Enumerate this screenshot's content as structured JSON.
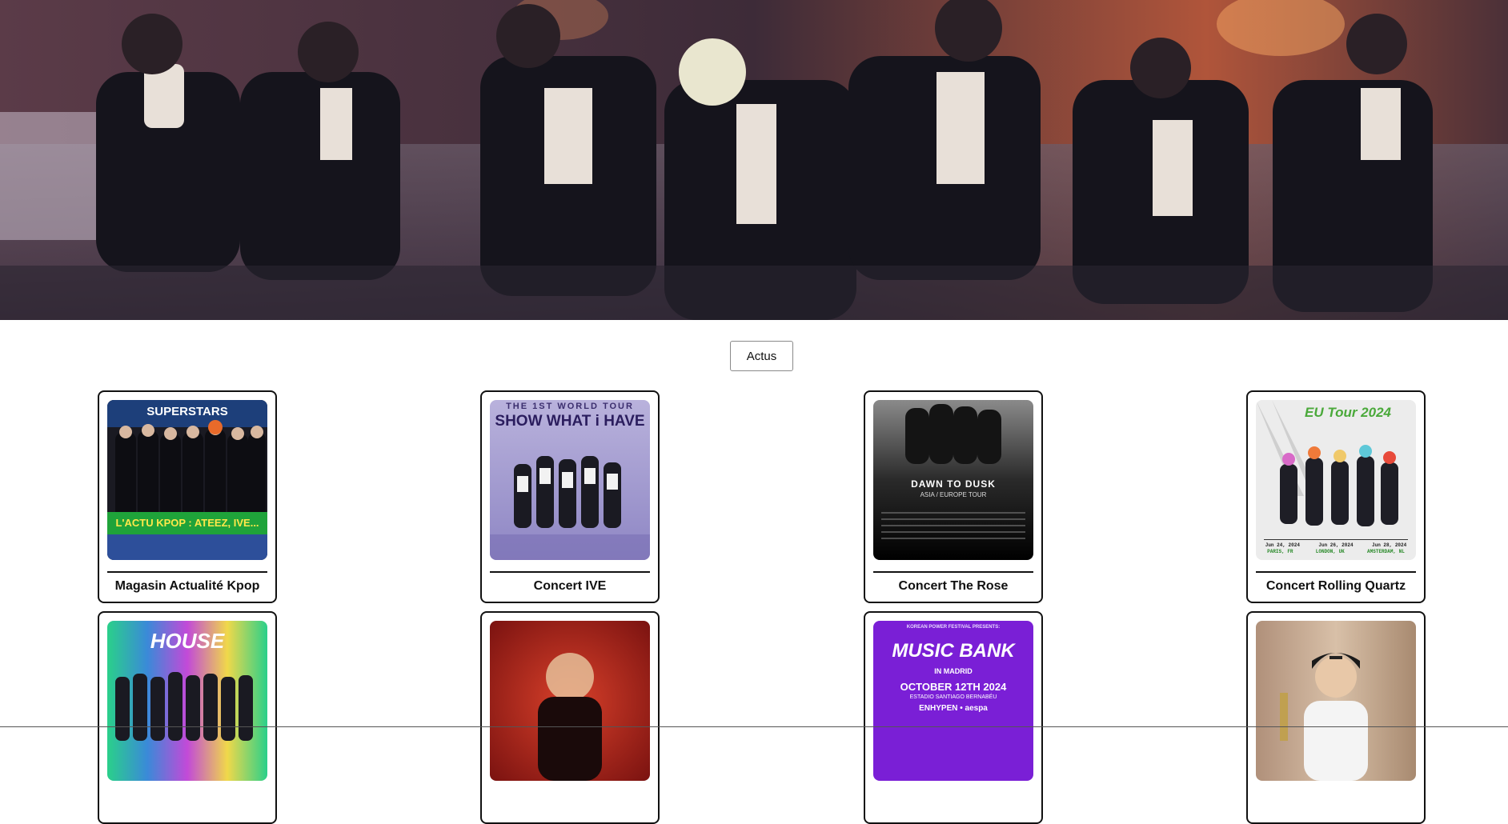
{
  "hero": {
    "image": "concert-group-photo"
  },
  "nav": {
    "actus_label": "Actus"
  },
  "cards": [
    {
      "caption": "Magasin Actualité Kpop",
      "poster_top": "SUPERSTARS",
      "poster_bottom": "L'ACTU KPOP : ATEEZ, IVE..."
    },
    {
      "caption": "Concert IVE",
      "poster_top": "THE 1ST WORLD TOUR",
      "poster_main": "SHOW WHAT i HAVE"
    },
    {
      "caption": "Concert The Rose",
      "poster_main": "DAWN TO DUSK",
      "poster_sub": "ASIA / EUROPE TOUR"
    },
    {
      "caption": "Concert Rolling Quartz",
      "poster_main": "EU Tour 2024",
      "poster_dates": [
        "Jun 24, 2024",
        "Jun 26, 2024",
        "Jun 28, 2024"
      ],
      "poster_cities": [
        "PARIS, FR",
        "LONDON, UK",
        "AMSTERDAM, NL"
      ]
    },
    {
      "caption": "",
      "poster_main": "HOUSE"
    },
    {
      "caption": "",
      "poster_main": ""
    },
    {
      "caption": "",
      "poster_top": "KOREAN POWER FESTIVAL PRESENTS:",
      "poster_main": "MUSIC BANK",
      "poster_sub": "IN MADRID",
      "poster_date": "OCTOBER 12TH 2024",
      "poster_venue": "ESTADIO SANTIAGO BERNABÉU",
      "poster_acts": "ENHYPEN • aespa"
    },
    {
      "caption": "",
      "poster_main": ""
    }
  ],
  "colors": {
    "border": "#111111",
    "accent_green": "#1fa33a",
    "accent_purple": "#7a1fd6"
  }
}
